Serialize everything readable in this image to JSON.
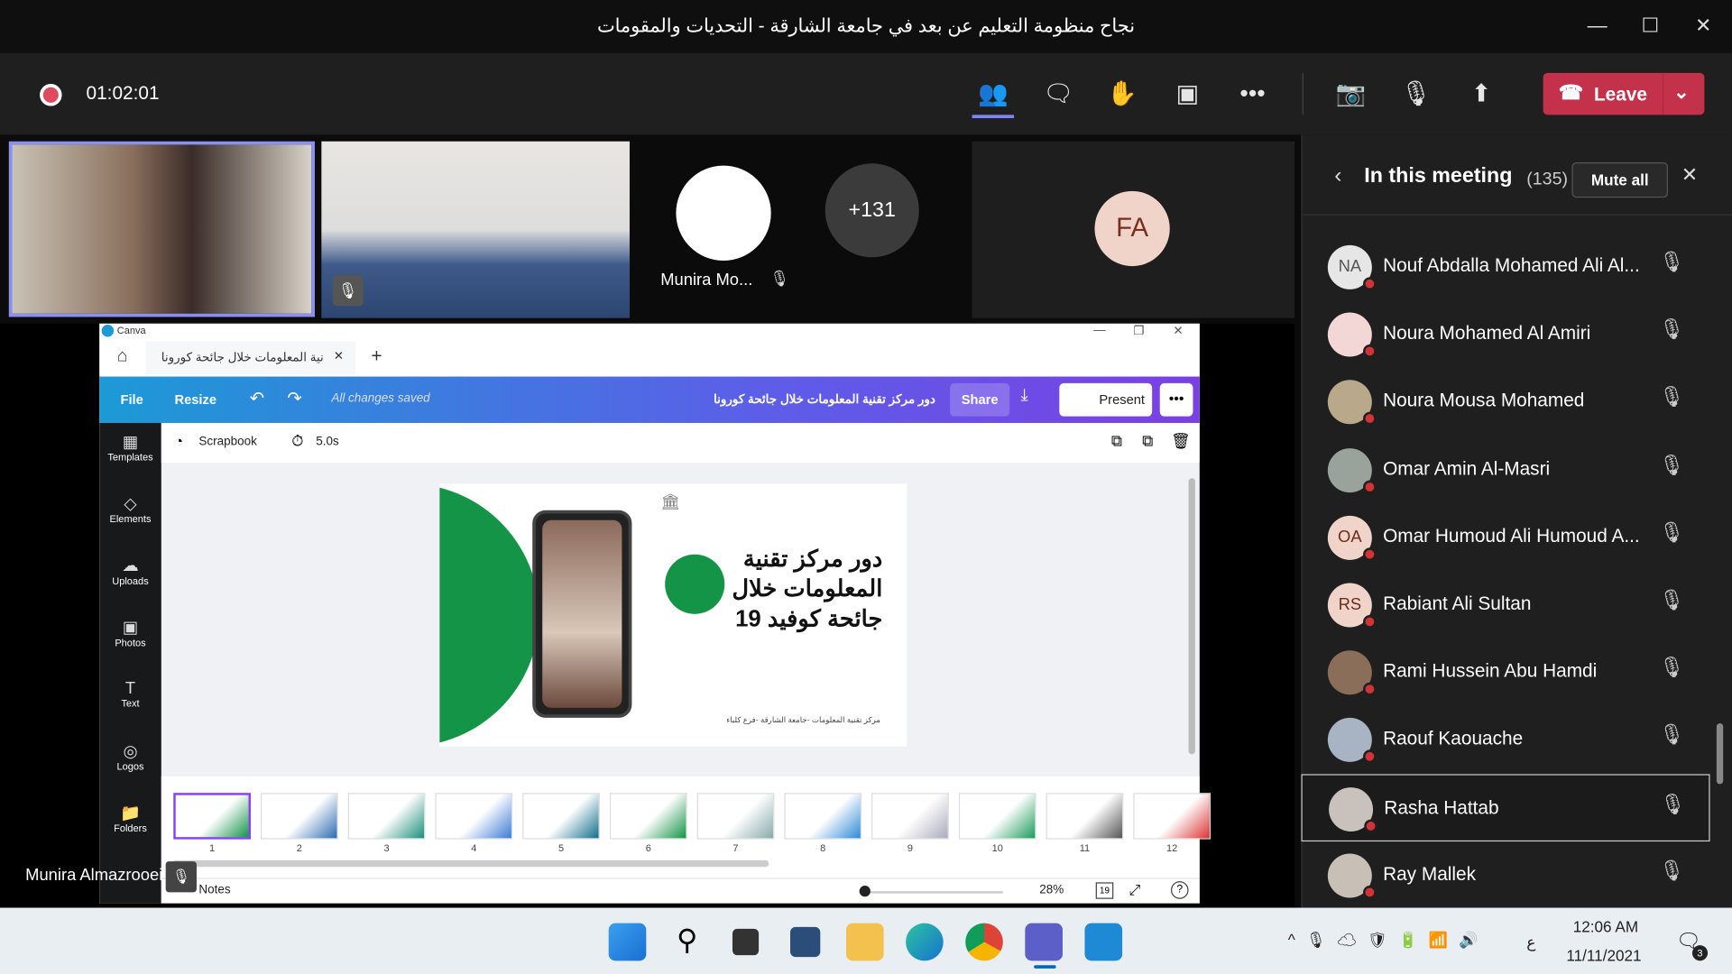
{
  "window": {
    "title": "نجاح منظومة التعليم عن بعد في جامعة الشارقة - التحديات والمقومات",
    "minimize": "—",
    "maximize": "☐",
    "close": "✕"
  },
  "meeting": {
    "timer": "01:02:01",
    "leave_label": "Leave",
    "accent": "#c4314b"
  },
  "toolbar_icons": [
    "people-icon",
    "chat-icon",
    "raise-hand-icon",
    "rooms-icon",
    "more-icon",
    "camera-off-icon",
    "mic-off-icon",
    "share-icon"
  ],
  "stage": {
    "tile3_name": "Munira Mo...",
    "overflow_count": "+131",
    "fa_initials": "FA",
    "presenter_name": "Munira Almazrooei"
  },
  "panel": {
    "title": "In this meeting",
    "count": "(135)",
    "mute_all": "Mute all",
    "participants": [
      {
        "name": "Nouf Abdalla Mohamed Ali Al...",
        "initials": "NA",
        "bg": "#e6e6e6",
        "fg": "#555"
      },
      {
        "name": "Noura Mohamed Al Amiri",
        "initials": "",
        "bg": "#f3d6d6"
      },
      {
        "name": "Noura Mousa Mohamed",
        "initials": "",
        "bg": "#b9a98a"
      },
      {
        "name": "Omar Amin Al-Masri",
        "initials": "",
        "bg": "#9aa39b"
      },
      {
        "name": "Omar Humoud Ali Humoud A...",
        "initials": "OA",
        "bg": "#f1d4c9",
        "fg": "#6b2c1a"
      },
      {
        "name": "Rabiant Ali Sultan",
        "initials": "RS",
        "bg": "#f1d4c9",
        "fg": "#6b2c1a"
      },
      {
        "name": "Rami Hussein Abu Hamdi",
        "initials": "",
        "bg": "#8a6e5a"
      },
      {
        "name": "Raouf Kaouache",
        "initials": "",
        "bg": "#a8b4c4"
      },
      {
        "name": "Rasha Hattab",
        "initials": "",
        "bg": "#c9c2bc",
        "selected": true
      },
      {
        "name": "Ray Mallek",
        "initials": "",
        "bg": "#c8c0b6"
      }
    ]
  },
  "canva": {
    "app_name": "Canva",
    "tab_title": "نية المعلومات خلال جائحة كورونا",
    "file": "File",
    "resize": "Resize",
    "saved": "All changes saved",
    "doc_title": "دور مركز تقنية المعلومات خلال جائحة كورونا",
    "share": "Share",
    "present": "Present",
    "sidebar": [
      "Templates",
      "Elements",
      "Uploads",
      "Photos",
      "Text",
      "Logos",
      "Folders"
    ],
    "scrapbook": "Scrapbook",
    "duration": "5.0s",
    "slide": {
      "heading_lines": [
        "دور مركز تقنية",
        "المعلومات خلال",
        "جائحة كوفيد 19"
      ],
      "footer": "مركز تقنية المعلومات -جامعة الشارقة -فرع كلباء"
    },
    "pages": [
      "1",
      "2",
      "3",
      "4",
      "5",
      "6",
      "7",
      "8",
      "9",
      "10",
      "11",
      "12"
    ],
    "notes": "Notes",
    "zoom": "28%",
    "page_indicator": "19",
    "brand_blue": "#1c9ad6",
    "brand_purple": "#7b3fe4"
  },
  "taskbar": {
    "time": "12:06 AM",
    "date": "11/11/2021",
    "lang": "ع",
    "notif_count": "3"
  }
}
